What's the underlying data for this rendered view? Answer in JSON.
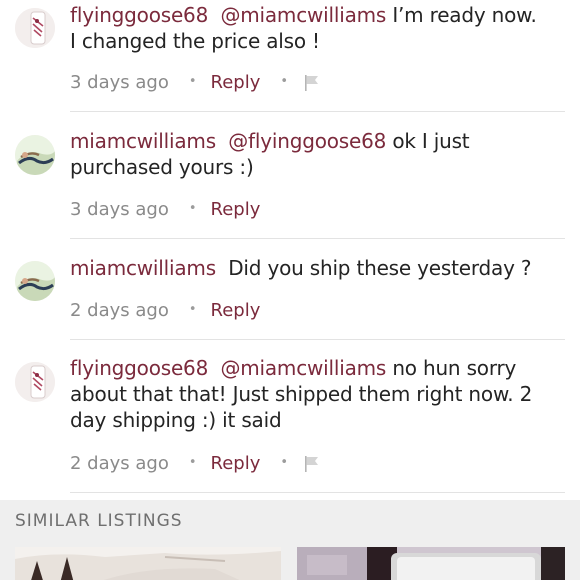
{
  "comments": [
    {
      "username": "flyinggoose68",
      "mention": "@miamcwilliams",
      "text": " I’m ready now. I changed the price also !",
      "timestamp": "3 days ago",
      "reply_label": "Reply",
      "avatar": "avatar-icon",
      "has_flag": true
    },
    {
      "username": "miamcwilliams",
      "mention": "@flyinggoose68",
      "text": " ok I just purchased yours :)",
      "timestamp": "3 days ago",
      "reply_label": "Reply",
      "avatar": "avatar-icon",
      "has_flag": false
    },
    {
      "username": "miamcwilliams",
      "mention": "",
      "text": "  Did you ship these yesterday ?",
      "timestamp": "2 days ago",
      "reply_label": "Reply",
      "avatar": "avatar-icon",
      "has_flag": false
    },
    {
      "username": "flyinggoose68",
      "mention": "@miamcwilliams",
      "text": " no hun sorry about that that! Just shipped them right now. 2 day shipping :) it said",
      "timestamp": "2 days ago",
      "reply_label": "Reply",
      "avatar": "avatar-icon",
      "has_flag": true
    }
  ],
  "similar_listings": {
    "title": "SIMILAR LISTINGS"
  },
  "colors": {
    "accent": "#7b2a3c",
    "meta": "#8a8a8a",
    "text": "#242424",
    "section_bg": "#efefef"
  }
}
